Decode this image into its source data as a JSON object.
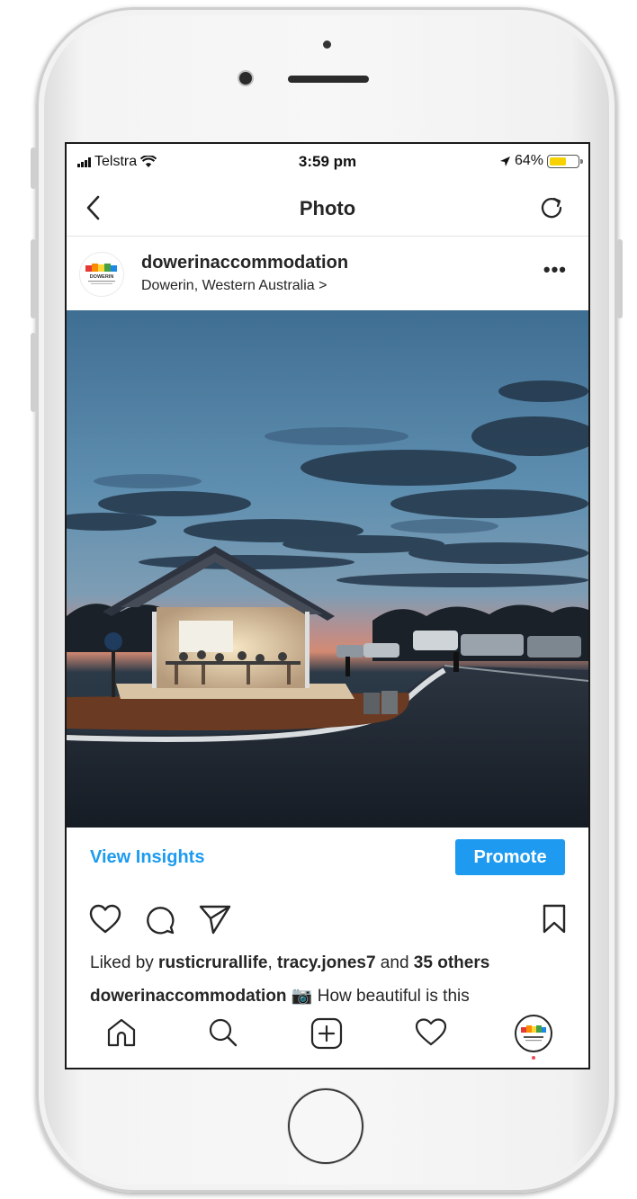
{
  "status_bar": {
    "carrier": "Telstra",
    "time": "3:59 pm",
    "battery_percent": "64%",
    "battery_level": 0.64
  },
  "navbar": {
    "title": "Photo"
  },
  "post": {
    "username": "dowerinaccommodation",
    "location": "Dowerin, Western Australia >",
    "more": "•••",
    "avatar_text": "DOWERIN"
  },
  "insights": {
    "view_insights": "View Insights",
    "promote": "Promote"
  },
  "likes": {
    "prefix": "Liked by ",
    "user1": "rusticrurallife",
    "sep": ", ",
    "user2": "tracy.jones7",
    "and": " and ",
    "others": "35 others"
  },
  "caption": {
    "username": "dowerinaccommodation",
    "emoji": "📷",
    "text": "How beautiful is this"
  },
  "colors": {
    "accent": "#1e9bf0",
    "text": "#262626",
    "battery": "#f7d200"
  },
  "icons": [
    "back-chevron-icon",
    "reload-icon",
    "heart-icon",
    "comment-icon",
    "share-icon",
    "bookmark-icon",
    "home-icon",
    "search-icon",
    "add-icon",
    "activity-heart-icon",
    "profile-avatar-icon"
  ]
}
